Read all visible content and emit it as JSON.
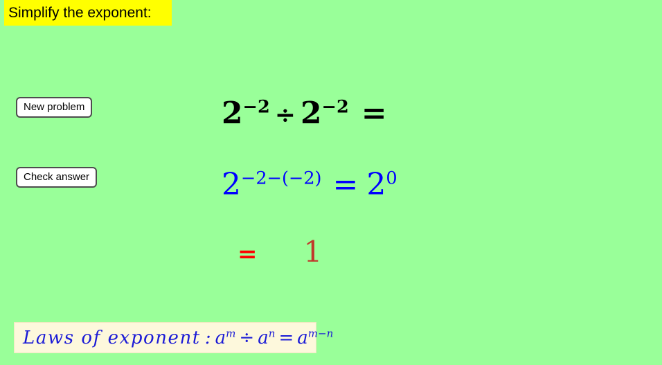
{
  "page": {
    "background_color": "#99ff99"
  },
  "title": {
    "text": "Simplify the exponent:",
    "background_color": "#ffff00",
    "text_color": "#000000"
  },
  "buttons": [
    {
      "id": "new-problem",
      "label": "New problem"
    },
    {
      "id": "check-answer",
      "label": "Check answer"
    }
  ],
  "problem": {
    "line1": {
      "color": "#000000",
      "base1": "2",
      "exp1": "−2",
      "operator": "÷",
      "base2": "2",
      "exp2": "−2",
      "equals": "="
    },
    "line2": {
      "color": "#0000ff",
      "base": "2",
      "exponent": "−2−(−2)",
      "equals": "=",
      "result_base": "2",
      "result_exp": "0"
    },
    "line3": {
      "equals": "=",
      "equals_color": "#ff0000",
      "value": "1",
      "value_color": "#c0392b"
    }
  },
  "laws": {
    "background_color": "#fdf8dc",
    "text_color": "#1a1ad6",
    "label": "Laws of exponent",
    "colon": ":",
    "base1": "a",
    "exp1": "m",
    "operator": "÷",
    "base2": "a",
    "exp2": "n",
    "equals": "=",
    "result_base": "a",
    "result_exp": "m−n"
  }
}
